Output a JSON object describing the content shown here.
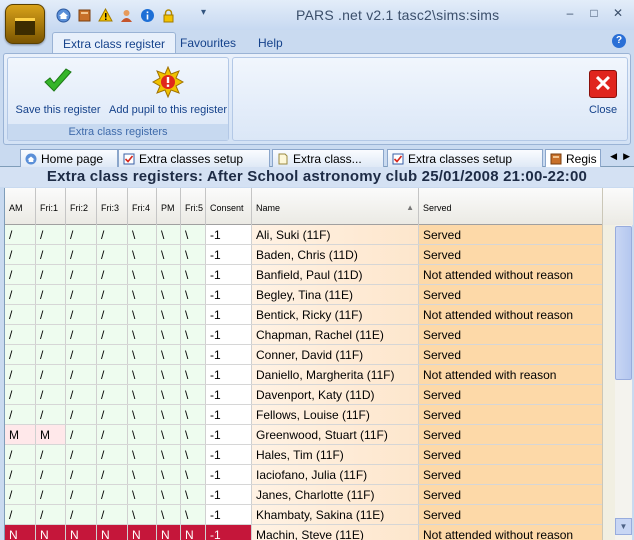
{
  "app": {
    "title": "PARS .net v2.1  tasc2\\sims:sims",
    "quick_access": [
      "home-icon",
      "book-icon",
      "warning-icon",
      "user-icon",
      "info-icon",
      "lock-icon"
    ]
  },
  "ribbon_tabs": [
    "Extra class register",
    "Favourites",
    "Help"
  ],
  "ribbon": {
    "group1": {
      "label": "Extra class registers",
      "save_label": "Save this register",
      "add_label": "Add pupil to this register"
    },
    "close_label": "Close"
  },
  "doc_tabs": [
    "Home page",
    "Extra classes setup",
    "Extra class...",
    "Extra classes setup",
    "Regis"
  ],
  "grid": {
    "title": "Extra class registers: After School astronomy club 25/01/2008 21:00-22:00",
    "columns": [
      "AM",
      "Fri:1",
      "Fri:2",
      "Fri:3",
      "Fri:4",
      "PM",
      "Fri:5",
      "Consent",
      "Name",
      "Served"
    ],
    "rows": [
      {
        "marks": [
          "/",
          "/",
          "/",
          "/",
          "\\",
          "\\",
          "\\"
        ],
        "consent": "-1",
        "name": "Ali, Suki (11F)",
        "served": "Served"
      },
      {
        "marks": [
          "/",
          "/",
          "/",
          "/",
          "\\",
          "\\",
          "\\"
        ],
        "consent": "-1",
        "name": "Baden, Chris (11D)",
        "served": "Served"
      },
      {
        "marks": [
          "/",
          "/",
          "/",
          "/",
          "\\",
          "\\",
          "\\"
        ],
        "consent": "-1",
        "name": "Banfield, Paul (11D)",
        "served": "Not attended without reason"
      },
      {
        "marks": [
          "/",
          "/",
          "/",
          "/",
          "\\",
          "\\",
          "\\"
        ],
        "consent": "-1",
        "name": "Begley, Tina (11E)",
        "served": "Served"
      },
      {
        "marks": [
          "/",
          "/",
          "/",
          "/",
          "\\",
          "\\",
          "\\"
        ],
        "consent": "-1",
        "name": "Bentick, Ricky (11F)",
        "served": "Not attended without reason"
      },
      {
        "marks": [
          "/",
          "/",
          "/",
          "/",
          "\\",
          "\\",
          "\\"
        ],
        "consent": "-1",
        "name": "Chapman, Rachel (11E)",
        "served": "Served"
      },
      {
        "marks": [
          "/",
          "/",
          "/",
          "/",
          "\\",
          "\\",
          "\\"
        ],
        "consent": "-1",
        "name": "Conner, David (11F)",
        "served": "Served"
      },
      {
        "marks": [
          "/",
          "/",
          "/",
          "/",
          "\\",
          "\\",
          "\\"
        ],
        "consent": "-1",
        "name": "Daniello, Margherita (11F)",
        "served": "Not attended with reason"
      },
      {
        "marks": [
          "/",
          "/",
          "/",
          "/",
          "\\",
          "\\",
          "\\"
        ],
        "consent": "-1",
        "name": "Davenport, Katy (11D)",
        "served": "Served"
      },
      {
        "marks": [
          "/",
          "/",
          "/",
          "/",
          "\\",
          "\\",
          "\\"
        ],
        "consent": "-1",
        "name": "Fellows, Louise (11F)",
        "served": "Served"
      },
      {
        "marks": [
          "M",
          "M",
          "/",
          "/",
          "\\",
          "\\",
          "\\"
        ],
        "consent": "-1",
        "name": "Greenwood, Stuart (11F)",
        "served": "Served"
      },
      {
        "marks": [
          "/",
          "/",
          "/",
          "/",
          "\\",
          "\\",
          "\\"
        ],
        "consent": "-1",
        "name": "Hales, Tim (11F)",
        "served": "Served"
      },
      {
        "marks": [
          "/",
          "/",
          "/",
          "/",
          "\\",
          "\\",
          "\\"
        ],
        "consent": "-1",
        "name": "Iaciofano, Julia (11F)",
        "served": "Served"
      },
      {
        "marks": [
          "/",
          "/",
          "/",
          "/",
          "\\",
          "\\",
          "\\"
        ],
        "consent": "-1",
        "name": "Janes, Charlotte (11F)",
        "served": "Served"
      },
      {
        "marks": [
          "/",
          "/",
          "/",
          "/",
          "\\",
          "\\",
          "\\"
        ],
        "consent": "-1",
        "name": "Khambaty, Sakina (11E)",
        "served": "Served"
      },
      {
        "marks": [
          "N",
          "N",
          "N",
          "N",
          "N",
          "N",
          "N"
        ],
        "consent": "-1",
        "name": "Machin, Steve (11E)",
        "served": "Not attended without reason",
        "absent": true
      }
    ]
  },
  "colors": {
    "attendance_bg": "#eefcef",
    "served_bg": "#fdd9a8",
    "absent_bg": "#c5163a"
  }
}
